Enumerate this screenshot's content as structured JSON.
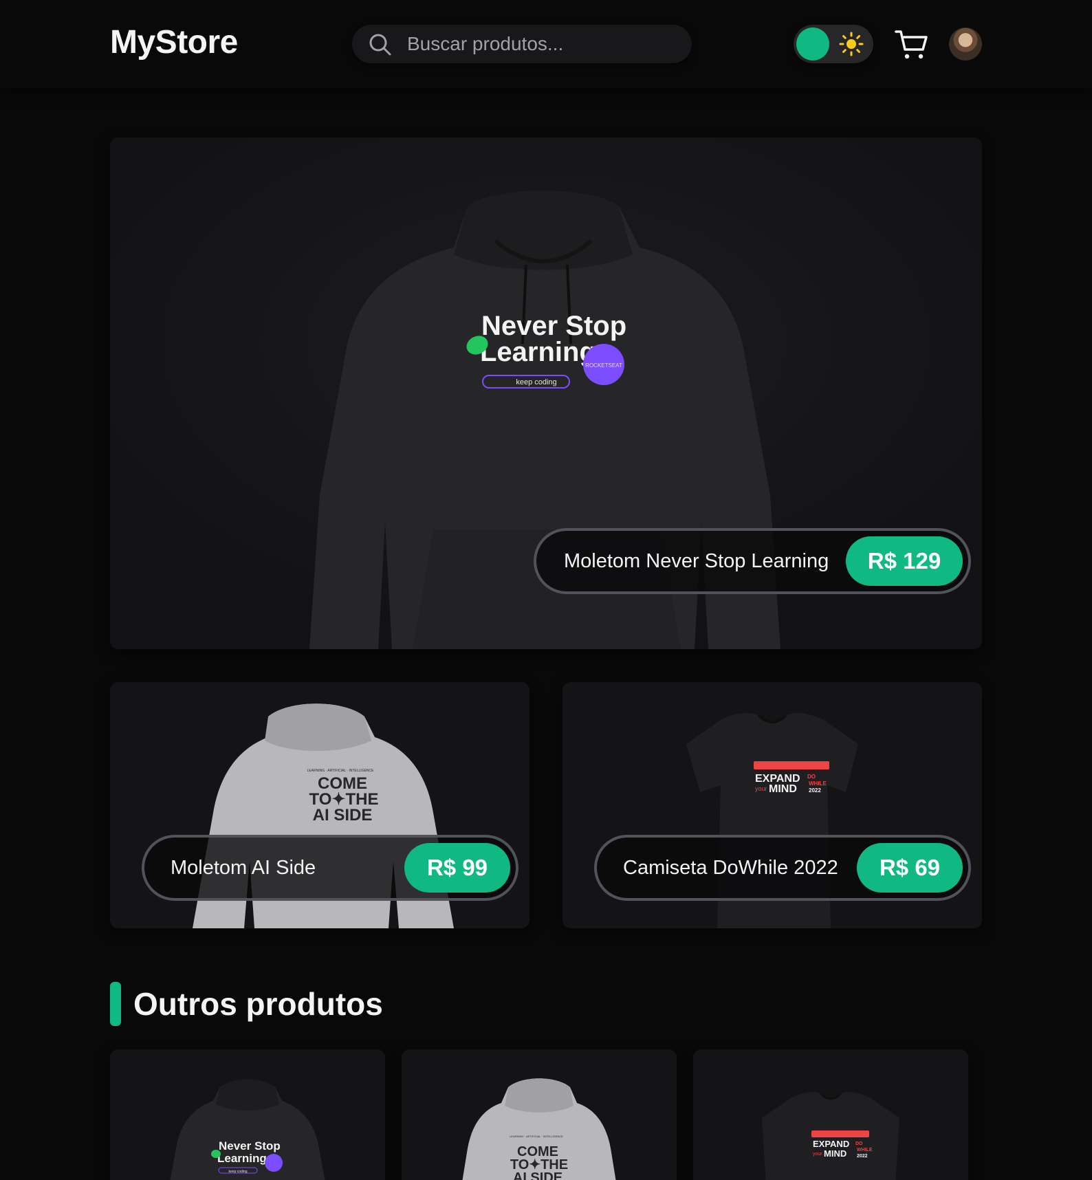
{
  "header": {
    "logo": "MyStore",
    "search_placeholder": "Buscar produtos...",
    "icons": {
      "search": "search-icon",
      "theme": "sun-icon",
      "cart": "cart-icon",
      "avatar": "user-avatar"
    },
    "theme_toggle_state": "dark"
  },
  "featured": {
    "name": "Moletom Never Stop Learning",
    "price": "R$ 129",
    "print": {
      "line1": "Never Stop",
      "line2": "Learning",
      "tag": "keep coding",
      "badge": "ROCKETSEAT"
    }
  },
  "secondary": [
    {
      "name": "Moletom AI Side",
      "price": "R$ 99",
      "print": {
        "small": "LEARNING · ARTIFICIAL · INTELLIGENCE",
        "line1": "COME",
        "line2": "TO✦THE",
        "line3": "AI SIDE"
      }
    },
    {
      "name": "Camiseta DoWhile 2022",
      "price": "R$ 69",
      "print": {
        "line1": "EXPAND",
        "line2": "MIND",
        "small": "your",
        "do": "DO",
        "while": "WHILE",
        "year": "2022"
      }
    }
  ],
  "others": {
    "title": "Outros produtos",
    "items": [
      {
        "print": {
          "line1": "Never Stop",
          "line2": "Learning",
          "tag": "keep coding"
        }
      },
      {
        "print": {
          "small": "LEARNING · ARTIFICIAL · INTELLIGENCE",
          "line1": "COME",
          "line2": "TO✦THE",
          "line3": "AI SIDE"
        }
      },
      {
        "print": {
          "line1": "EXPAND",
          "line2": "MIND",
          "small": "your",
          "do": "DO",
          "while": "WHILE",
          "year": "2022"
        }
      }
    ]
  },
  "colors": {
    "accent": "#10b981",
    "background": "#09090a",
    "card": "#141416",
    "sun": "#facc15",
    "badge": "#7c4dff"
  }
}
